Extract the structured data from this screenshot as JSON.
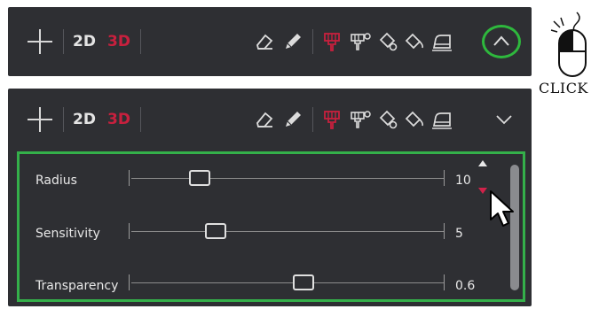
{
  "toolbar": {
    "mode_2d": "2D",
    "mode_3d": "3D",
    "tools": [
      "add-icon",
      "eraser-icon",
      "pencil-icon",
      "brush-icon",
      "smart-brush-icon",
      "fill-icon",
      "fill-bucket-icon",
      "iron-icon"
    ],
    "collapse_icon": "chevron-up-icon",
    "expand_icon": "chevron-down-icon",
    "active_mode": "3D",
    "active_tool": "brush-icon"
  },
  "sliders": [
    {
      "label": "Radius",
      "value": "10",
      "position_fraction": 0.22
    },
    {
      "label": "Sensitivity",
      "value": "5",
      "position_fraction": 0.27
    },
    {
      "label": "Transparency",
      "value": "0.6",
      "position_fraction": 0.55
    }
  ],
  "annotation": {
    "click_label": "CLICK"
  },
  "colors": {
    "toolbar_bg": "#2e2f33",
    "accent_red": "#c8203e",
    "highlight_green": "#34b04a"
  }
}
